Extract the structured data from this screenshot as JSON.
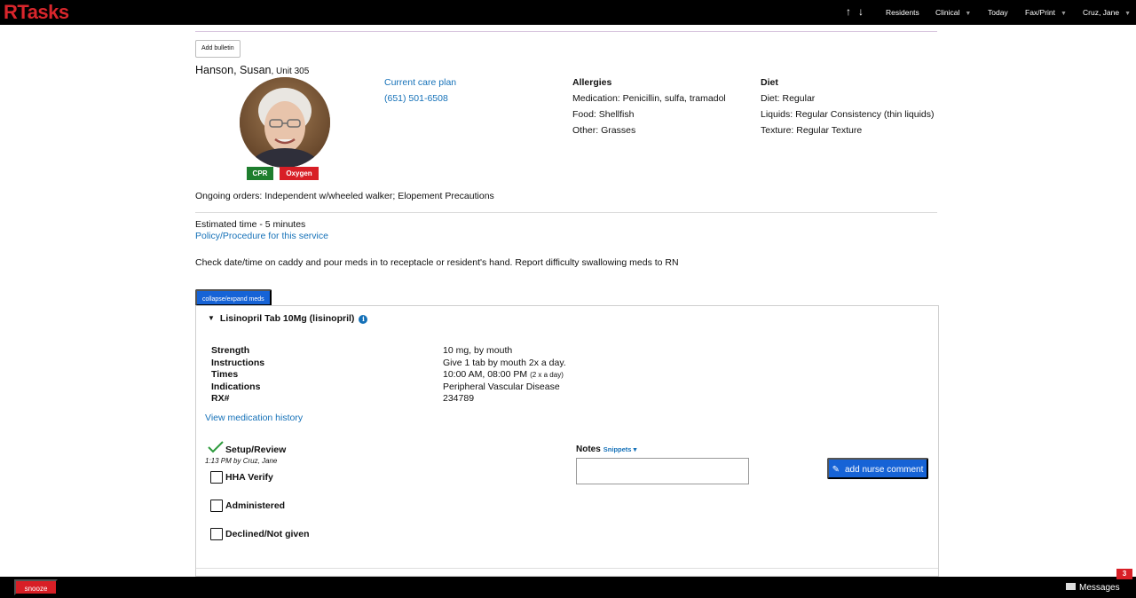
{
  "app": {
    "logo": "RTasks"
  },
  "topnav": {
    "items": [
      {
        "label": "Residents"
      },
      {
        "label": "Clinical"
      },
      {
        "label": "Today"
      },
      {
        "label": "Fax/Print"
      },
      {
        "label": "Cruz, Jane"
      }
    ]
  },
  "header": {
    "add_bulletin": "Add bulletin",
    "resident_name": "Hanson, Susan",
    "unit": ", Unit 305",
    "badges": {
      "cpr": "CPR",
      "oxygen": "Oxygen"
    },
    "care_plan": "Current care plan",
    "phone": "(651) 501-6508"
  },
  "allergies": {
    "title": "Allergies",
    "lines": [
      "Medication: Penicillin, sulfa, tramadol",
      "Food: Shellfish",
      "Other: Grasses"
    ]
  },
  "diet": {
    "title": "Diet",
    "lines": [
      "Diet: Regular",
      "Liquids: Regular Consistency (thin liquids)",
      "Texture: Regular Texture"
    ]
  },
  "orders": "Ongoing orders: Independent w/wheeled walker; Elopement Precautions",
  "service": {
    "estimated_time": "Estimated time - 5 minutes",
    "policy_link": "Policy/Procedure for this service",
    "instructions": "Check date/time on caddy and pour meds in to receptacle or resident's hand. Report difficulty swallowing meds to RN",
    "collapse_button": "collapse/expand meds"
  },
  "medication": {
    "title": "Lisinopril Tab 10Mg (lisinopril)",
    "details": [
      {
        "label": "Strength",
        "value": "10 mg, by mouth",
        "extra": ""
      },
      {
        "label": "Instructions",
        "value": "Give 1 tab by mouth 2x a day.",
        "extra": ""
      },
      {
        "label": "Times",
        "value": "10:00 AM, 08:00 PM",
        "extra": "(2 x a day)"
      },
      {
        "label": "Indications",
        "value": "Peripheral Vascular Disease",
        "extra": ""
      },
      {
        "label": "RX#",
        "value": "234789",
        "extra": ""
      }
    ],
    "history_link": "View medication history",
    "setup": {
      "label": "Setup/Review",
      "meta": "1:13 PM by Cruz, Jane"
    },
    "checkboxes": [
      {
        "label": "HHA Verify"
      },
      {
        "label": "Administered"
      },
      {
        "label": "Declined/Not given"
      }
    ],
    "notes_label": "Notes",
    "snippets": "Snippets",
    "notes_value": "",
    "nurse_button": "add nurse comment"
  },
  "footer": {
    "snooze": "snooze",
    "messages": "Messages",
    "message_count": "3"
  },
  "colors": {
    "brand_red": "#d81f26",
    "link_blue": "#1571b8",
    "button_blue": "#1663d6",
    "success_green": "#1e7e2e"
  }
}
